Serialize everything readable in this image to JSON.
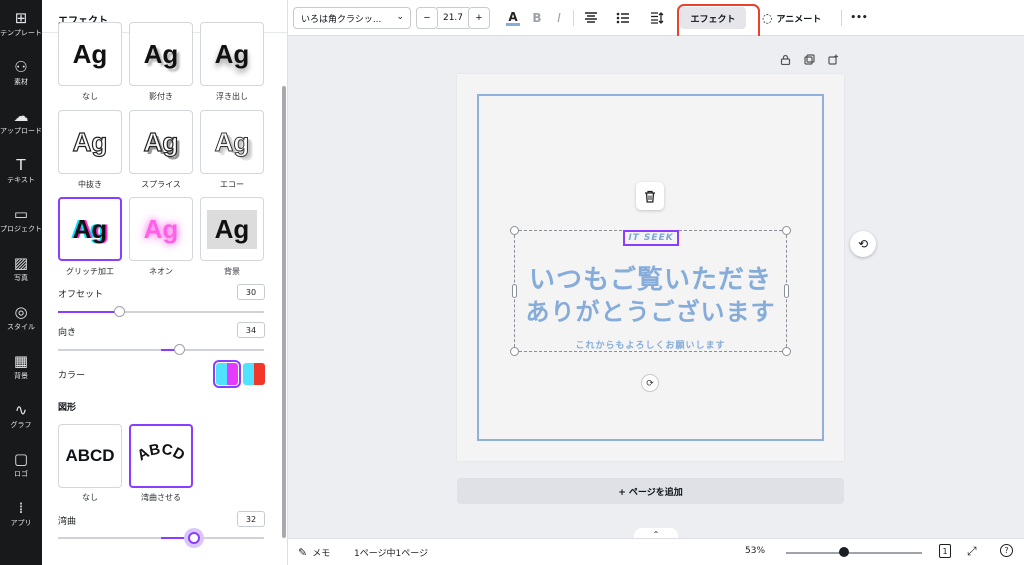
{
  "rail": {
    "items": [
      {
        "icon": "⊞",
        "label": "テンプレート",
        "name": "templates"
      },
      {
        "icon": "⚇",
        "label": "素材",
        "name": "elements"
      },
      {
        "icon": "☁",
        "label": "アップロード",
        "name": "uploads"
      },
      {
        "icon": "T",
        "label": "テキスト",
        "name": "text"
      },
      {
        "icon": "▭",
        "label": "プロジェクト",
        "name": "projects"
      },
      {
        "icon": "▨",
        "label": "写真",
        "name": "photos"
      },
      {
        "icon": "◎",
        "label": "スタイル",
        "name": "styles"
      },
      {
        "icon": "▦",
        "label": "背景",
        "name": "background"
      },
      {
        "icon": "∿",
        "label": "グラフ",
        "name": "charts"
      },
      {
        "icon": "▢",
        "label": "ロゴ",
        "name": "logos"
      },
      {
        "icon": "⁞",
        "label": "アプリ",
        "name": "apps"
      }
    ]
  },
  "panel": {
    "title": "エフェクト",
    "effects": [
      {
        "sample": "Ag",
        "label": "なし",
        "style": "none"
      },
      {
        "sample": "Ag",
        "label": "影付き",
        "style": "shadow"
      },
      {
        "sample": "Ag",
        "label": "浮き出し",
        "style": "lift"
      },
      {
        "sample": "Ag",
        "label": "中抜き",
        "style": "hollow"
      },
      {
        "sample": "Ag",
        "label": "スプライス",
        "style": "splice"
      },
      {
        "sample": "Ag",
        "label": "エコー",
        "style": "echo"
      },
      {
        "sample": "Ag",
        "label": "グリッチ加工",
        "style": "glitch",
        "selected": true
      },
      {
        "sample": "Ag",
        "label": "ネオン",
        "style": "neon"
      },
      {
        "sample": "Ag",
        "label": "背景",
        "style": "bg"
      }
    ],
    "offset": {
      "label": "オフセット",
      "value": "30",
      "fraction": 0.3
    },
    "direction": {
      "label": "向き",
      "value": "34",
      "fraction": 0.59
    },
    "color": {
      "label": "カラー",
      "swatch1": [
        "#4fe3ff",
        "#e53bff"
      ],
      "swatch2": [
        "#4fe3ff",
        "#f0372a"
      ]
    },
    "shape": {
      "title": "図形",
      "options": [
        {
          "sample": "ABCD",
          "label": "なし"
        },
        {
          "sample": "ABCD",
          "label": "湾曲させる",
          "selected": true
        }
      ]
    },
    "curve": {
      "label": "湾曲",
      "value": "32",
      "fraction": 0.66
    }
  },
  "toolbar": {
    "font": "いろは角クラシッ...",
    "size": "21.7",
    "minus": "−",
    "plus": "+",
    "text_color_icon": "A",
    "bold": "B",
    "italic": "I",
    "effect_label": "エフェクト",
    "animate_label": "アニメート",
    "more": "•••"
  },
  "canvas": {
    "badge": "IT SEEK",
    "line1": "いつもご覧いただき",
    "line2": "ありがとうございます",
    "sub": "これからもよろしくお願いします",
    "add_page": "+ ページを追加",
    "text_color": "#86acd9"
  },
  "bottom": {
    "memo": "メモ",
    "page_info": "1ページ中1ページ",
    "zoom": "53%",
    "zoom_fraction": 0.53,
    "page_count": "1",
    "help": "?"
  }
}
